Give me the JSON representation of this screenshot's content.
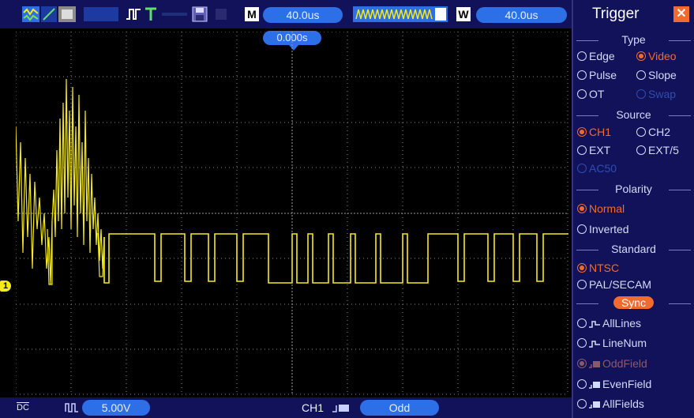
{
  "toolbar": {
    "timebase_mode_label": "M",
    "timebase_value": "40.0us",
    "window_mode_label": "W",
    "window_value": "40.0us",
    "trigger_position": "0.000s"
  },
  "status_bar": {
    "channel_marker": "1",
    "coupling_label": "DC",
    "volts_per_div": "5.00V",
    "trigger_source": "CH1",
    "trigger_field": "Odd"
  },
  "trigger_panel": {
    "title": "Trigger",
    "close_symbol": "✕",
    "type_heading": "Type",
    "type_options": {
      "edge": "Edge",
      "video": "Video",
      "pulse": "Pulse",
      "slope": "Slope",
      "ot": "OT",
      "swap": "Swap"
    },
    "source_heading": "Source",
    "source_options": {
      "ch1": "CH1",
      "ch2": "CH2",
      "ext": "EXT",
      "ext5": "EXT/5",
      "acline": "AC50"
    },
    "polarity_heading": "Polarity",
    "polarity_options": {
      "normal": "Normal",
      "inverted": "Inverted"
    },
    "standard_heading": "Standard",
    "standard_options": {
      "ntsc": "NTSC",
      "pal": "PAL/SECAM"
    },
    "sync_heading": "Sync",
    "sync_options": {
      "all_lines": "AllLines",
      "line_num": "LineNum",
      "odd_field": "OddField",
      "even_field": "EvenField",
      "all_fields": "AllFields"
    }
  },
  "colors": {
    "trace": "#f5ea1c",
    "accent": "#2d6fe6",
    "selected": "#f26a2c",
    "panel_bg": "#12125a",
    "grid": "#8a8a8a"
  }
}
